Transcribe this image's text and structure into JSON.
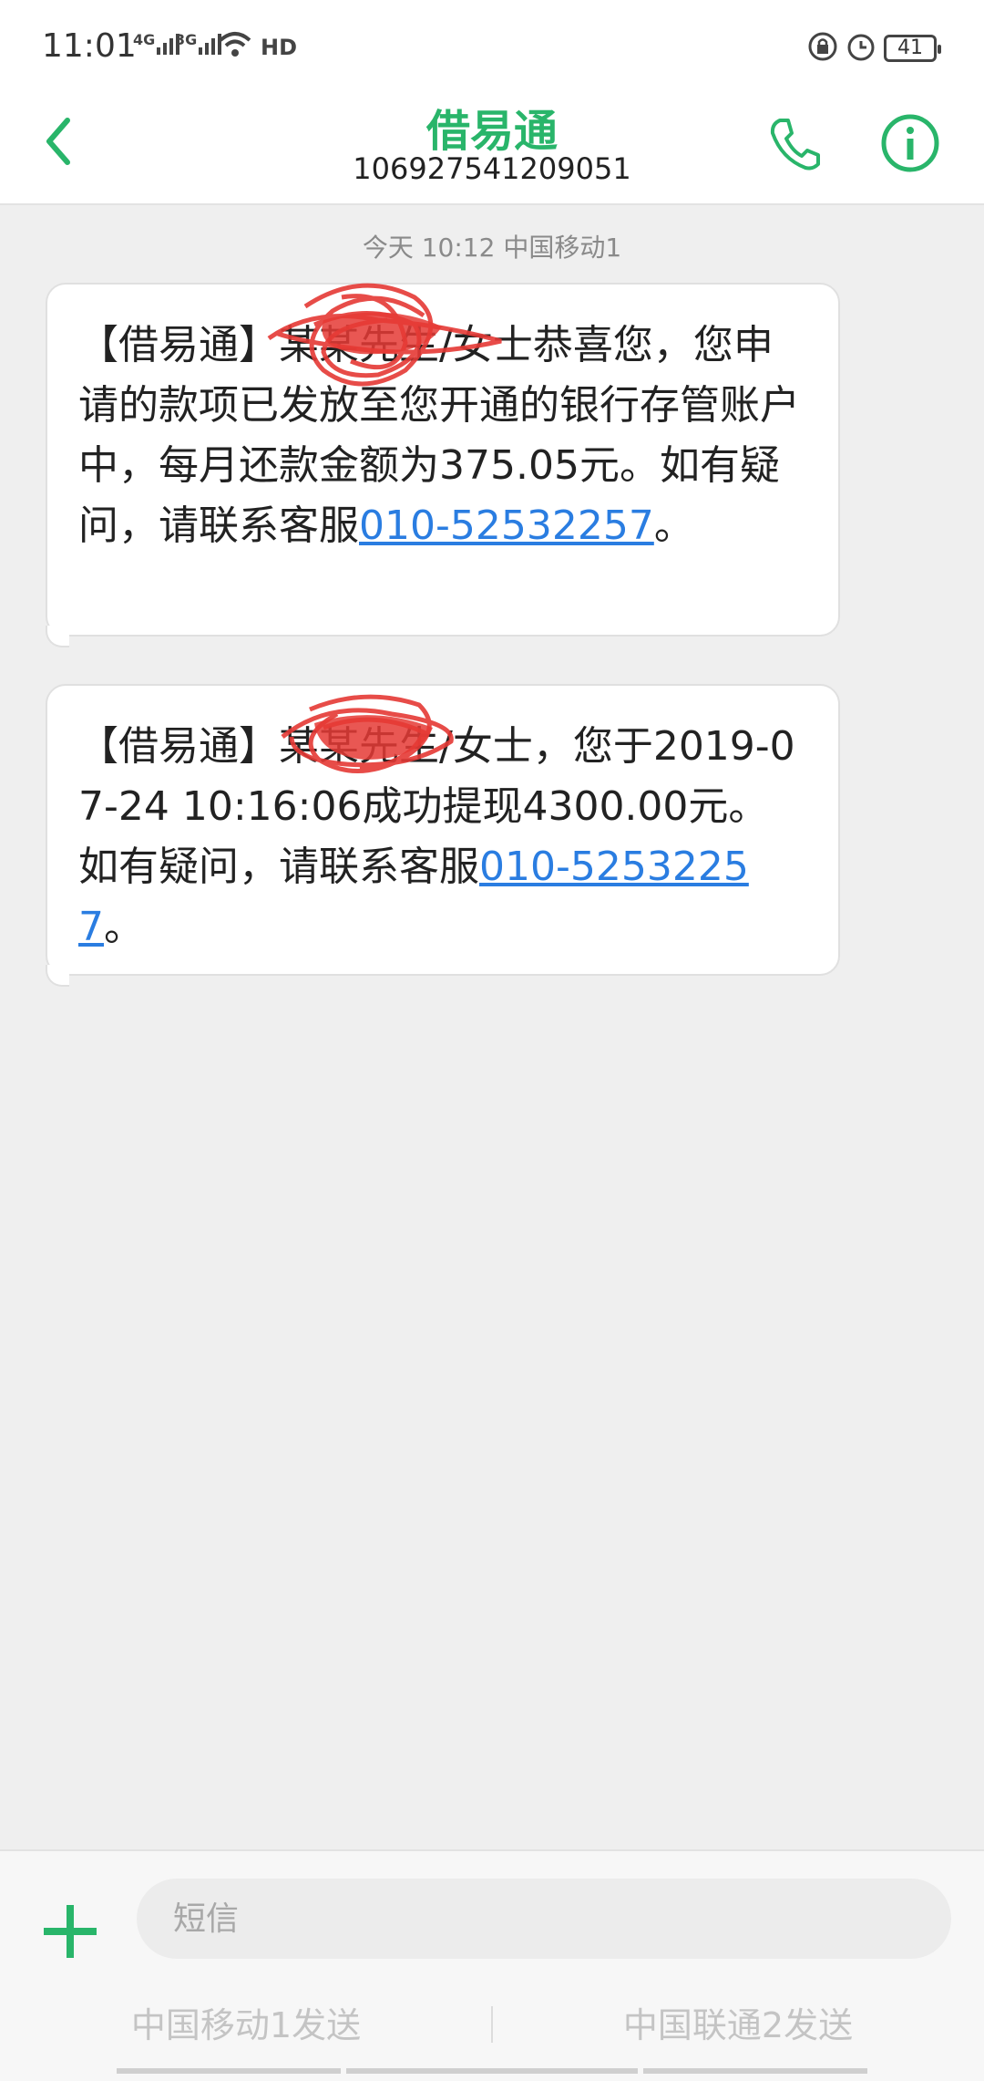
{
  "status_bar": {
    "time": "11:01",
    "signal_1": "4G",
    "signal_2": "3G",
    "hd": "HD",
    "battery": "41"
  },
  "header": {
    "title": "借易通",
    "number": "106927541209051"
  },
  "conversation": {
    "timestamp": "今天 10:12  中国移动1",
    "messages": [
      {
        "text": "【借易通】某某先生/女士恭喜您，您申请的款项已发放至您开通的银行存管账户中，每月还款金额为375.05元。如有疑问，请联系客服",
        "link": "010-52532257",
        "tail": "。"
      },
      {
        "text": "【借易通】某某先生/女士，您于2019-07-24 10:16:06成功提现4300.00元。如有疑问，请联系客服",
        "link": "010-52532257",
        "tail": "。"
      }
    ]
  },
  "composer": {
    "placeholder": "短信",
    "send_sim1": "中国移动1发送",
    "send_sim2": "中国联通2发送"
  },
  "colors": {
    "accent": "#29b56a",
    "link": "#2a7de1",
    "redaction": "#e53935"
  }
}
